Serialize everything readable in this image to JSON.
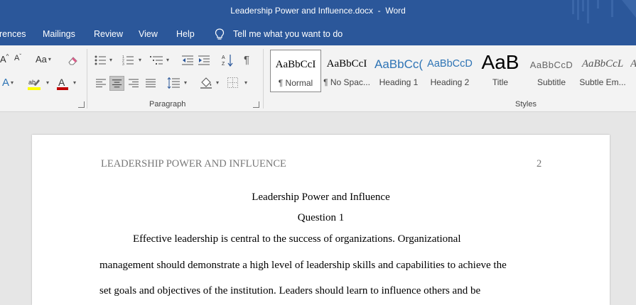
{
  "window": {
    "title": "Leadership Power and Influence.docx  -  Word"
  },
  "menu": {
    "items": [
      "rences",
      "Mailings",
      "Review",
      "View",
      "Help"
    ],
    "tell_me": "Tell me what you want to do"
  },
  "ribbon": {
    "font_group": {
      "grow_font": "A",
      "shrink_font": "A",
      "change_case": "Aa",
      "text_effects": "A",
      "font_color": "A"
    },
    "paragraph_label": "Paragraph",
    "styles_label": "Styles",
    "styles": [
      {
        "sample": "AaBbCcI",
        "name": "¶ Normal",
        "selected": true
      },
      {
        "sample": "AaBbCcI",
        "name": "¶ No Spac...",
        "selected": false
      },
      {
        "sample": "AaBbCc(",
        "name": "Heading 1",
        "selected": false
      },
      {
        "sample": "AaBbCcD",
        "name": "Heading 2",
        "selected": false
      },
      {
        "sample": "AaB",
        "name": "Title",
        "selected": false
      },
      {
        "sample": "AaBbCcD",
        "name": "Subtitle",
        "selected": false
      },
      {
        "sample": "AaBbCcL",
        "name": "Subtle Em...",
        "selected": false
      },
      {
        "sample": "A",
        "name": "",
        "selected": false
      }
    ],
    "colors": {
      "highlight": "#ffff00",
      "font_color": "#c00000",
      "heading_blue": "#2e74b5"
    }
  },
  "document": {
    "header_text": "LEADERSHIP POWER AND INFLUENCE",
    "page_number": "2",
    "title": "Leadership Power and Influence",
    "subtitle": "Question 1",
    "lines": [
      "Effective leadership is central to the success of organizations. Organizational",
      "management should demonstrate a high level of leadership skills and capabilities to achieve the",
      "set goals and objectives of the institution. Leaders should learn to influence others and be"
    ]
  },
  "theme": {
    "title_bar": "#2b579a",
    "ribbon_bg": "#f3f3f3",
    "canvas_bg": "#e6e6e6"
  }
}
